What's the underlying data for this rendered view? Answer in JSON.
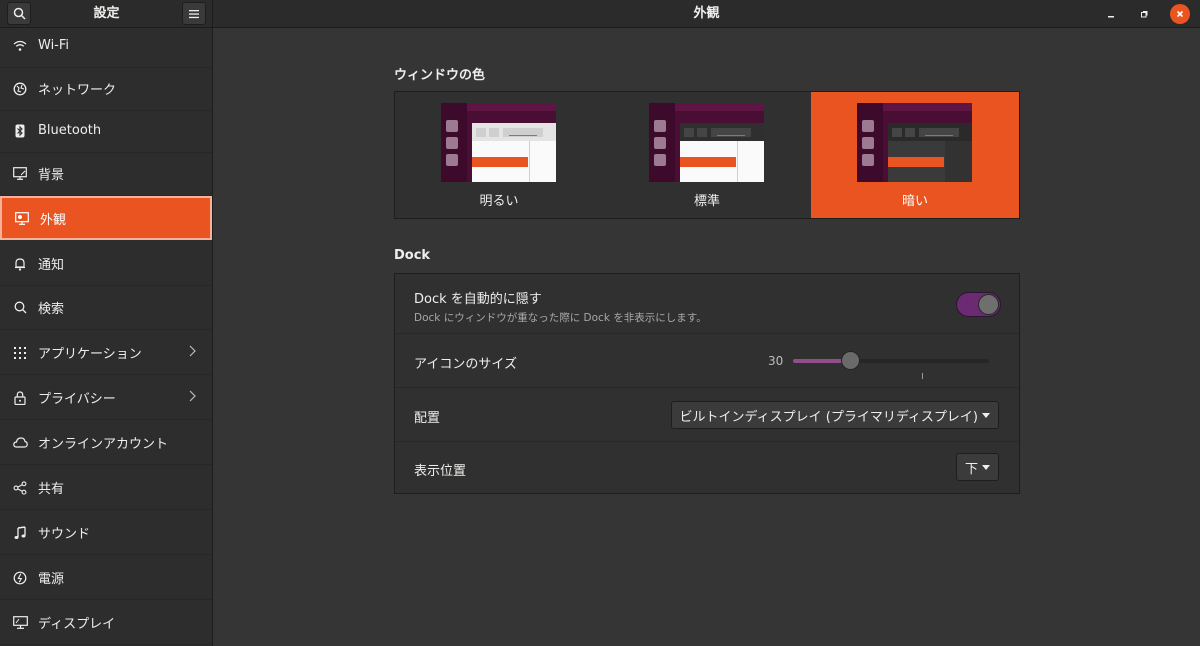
{
  "app": {
    "title": "設定",
    "panel_title": "外観"
  },
  "sidebar": {
    "items": [
      {
        "label": "Wi-Fi",
        "icon": "wifi-icon"
      },
      {
        "label": "ネットワーク",
        "icon": "network-icon"
      },
      {
        "label": "Bluetooth",
        "icon": "bluetooth-icon"
      },
      {
        "label": "背景",
        "icon": "background-icon"
      },
      {
        "label": "外観",
        "icon": "appearance-icon",
        "active": true
      },
      {
        "label": "通知",
        "icon": "bell-icon"
      },
      {
        "label": "検索",
        "icon": "search-icon"
      },
      {
        "label": "アプリケーション",
        "icon": "apps-grid-icon",
        "submenu": true
      },
      {
        "label": "プライバシー",
        "icon": "lock-icon",
        "submenu": true
      },
      {
        "label": "オンラインアカウント",
        "icon": "cloud-icon"
      },
      {
        "label": "共有",
        "icon": "share-icon"
      },
      {
        "label": "サウンド",
        "icon": "music-note-icon"
      },
      {
        "label": "電源",
        "icon": "power-icon"
      },
      {
        "label": "ディスプレイ",
        "icon": "display-icon"
      }
    ]
  },
  "window_color": {
    "title": "ウィンドウの色",
    "options": [
      {
        "label": "明るい"
      },
      {
        "label": "標準"
      },
      {
        "label": "暗い",
        "selected": true
      }
    ]
  },
  "dock": {
    "title": "Dock",
    "autohide": {
      "label": "Dock を自動的に隠す",
      "description": "Dock にウィンドウが重なった際に Dock を非表示にします。",
      "enabled": true
    },
    "icon_size": {
      "label": "アイコンのサイズ",
      "value": "30",
      "min": 16,
      "max": 64,
      "current": 30
    },
    "placement": {
      "label": "配置",
      "value": "ビルトインディスプレイ (プライマリディスプレイ)"
    },
    "position": {
      "label": "表示位置",
      "value": "下"
    }
  },
  "colors": {
    "accent": "#e95420",
    "toggle_on": "#6b2a72",
    "slider_fill": "#924d8b"
  }
}
